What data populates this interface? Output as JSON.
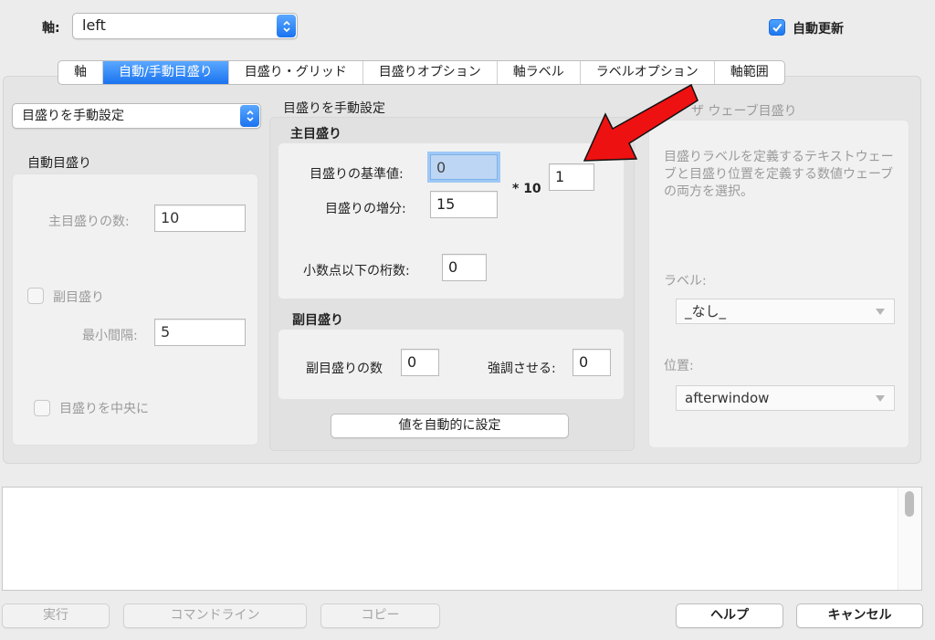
{
  "header": {
    "axis_label": "軸:",
    "axis_value": "left",
    "auto_update_label": "自動更新",
    "auto_update_checked": true
  },
  "tabs": [
    {
      "label": "軸",
      "active": false
    },
    {
      "label": "自動/手動目盛り",
      "active": true
    },
    {
      "label": "目盛り・グリッド",
      "active": false
    },
    {
      "label": "目盛りオプション",
      "active": false
    },
    {
      "label": "軸ラベル",
      "active": false
    },
    {
      "label": "ラベルオプション",
      "active": false
    },
    {
      "label": "軸範囲",
      "active": false
    }
  ],
  "left": {
    "mode_value": "目盛りを手動設定",
    "auto_group_label": "自動目盛り",
    "major_count_label": "主目盛りの数:",
    "major_count_value": "10",
    "minor_ticks_label": "副目盛り",
    "min_interval_label": "最小間隔:",
    "min_interval_value": "5",
    "center_ticks_label": "目盛りを中央に"
  },
  "manual": {
    "group_label": "目盛りを手動設定",
    "major_group_label": "主目盛り",
    "base_label": "目盛りの基準値:",
    "base_value": "0",
    "exponent_prefix": "* 10",
    "exponent_value": "1",
    "increment_label": "目盛りの増分:",
    "increment_value": "15",
    "decimals_label": "小数点以下の桁数:",
    "decimals_value": "0",
    "minor_group_label": "副目盛り",
    "minor_count_label": "副目盛りの数",
    "minor_count_value": "0",
    "emphasize_label": "強調させる:",
    "emphasize_value": "0",
    "auto_set_button": "値を自動的に設定"
  },
  "wave": {
    "group_label": "ザ ウェーブ目盛り",
    "description": "目盛りラベルを定義するテキストウェーブと目盛り位置を定義する数値ウェーブの両方を選択。",
    "label_label": "ラベル:",
    "label_value": "_なし_",
    "position_label": "位置:",
    "position_value": "afterwindow"
  },
  "footer": {
    "run": "実行",
    "command_line": "コマンドライン",
    "copy": "コピー",
    "help": "ヘルプ",
    "cancel": "キャンセル"
  },
  "annotation": {
    "arrow_color": "#ee1111"
  }
}
